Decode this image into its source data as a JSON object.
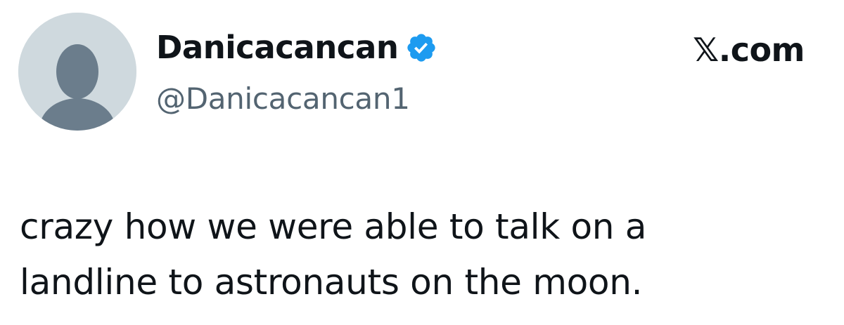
{
  "author": {
    "display_name": "Danicacancan",
    "handle": "@Danicacancan1",
    "verified": true,
    "avatar": "default-profile-avatar"
  },
  "site_label": "𝕏.com",
  "tweet": {
    "lines": [
      "crazy how we were able to talk on a",
      "landline to astronauts on the moon."
    ]
  },
  "colors": {
    "background": "#ffffff",
    "text": "#0f1419",
    "secondary_text": "#536471",
    "verified_blue": "#1d9bf0",
    "avatar_bg": "#cfd9de",
    "avatar_silhouette": "#6b7d8c"
  },
  "icons": {
    "verified": "verified-badge-icon",
    "avatar": "default-avatar-icon"
  }
}
